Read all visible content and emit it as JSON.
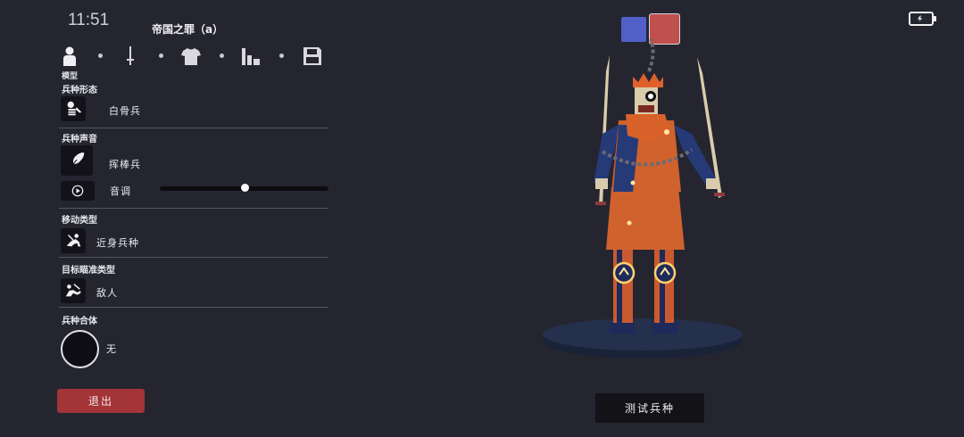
{
  "status_bar": {
    "time": "11:51"
  },
  "unit": {
    "title": "帝国之罪（a）"
  },
  "tabs": [
    {
      "name": "模型",
      "icon": "person-icon"
    },
    {
      "icon": "sword-icon"
    },
    {
      "icon": "shirt-icon"
    },
    {
      "icon": "stats-icon"
    },
    {
      "icon": "save-icon"
    }
  ],
  "active_tab_label": "模型",
  "sections": {
    "unit_form": {
      "label": "兵种形态",
      "value": "白骨兵",
      "icon": "skeleton-icon"
    },
    "unit_voice": {
      "label": "兵种声音",
      "value": "挥棒兵",
      "icon": "feather-icon",
      "pitch_label": "音调",
      "pitch": 0.5
    },
    "movement": {
      "label": "移动类型",
      "value": "近身兵种",
      "icon": "melee-icon"
    },
    "targeting": {
      "label": "目标瞄准类型",
      "value": "敌人",
      "icon": "target-enemy-icon"
    },
    "unit_merge": {
      "label": "兵种合体",
      "value": "无"
    }
  },
  "buttons": {
    "exit": "退出",
    "test_unit": "测试兵种"
  },
  "colors": {
    "team_blue": "#5060c8",
    "team_red": "#c0504e",
    "exit": "#a33537",
    "background": "#252530"
  }
}
